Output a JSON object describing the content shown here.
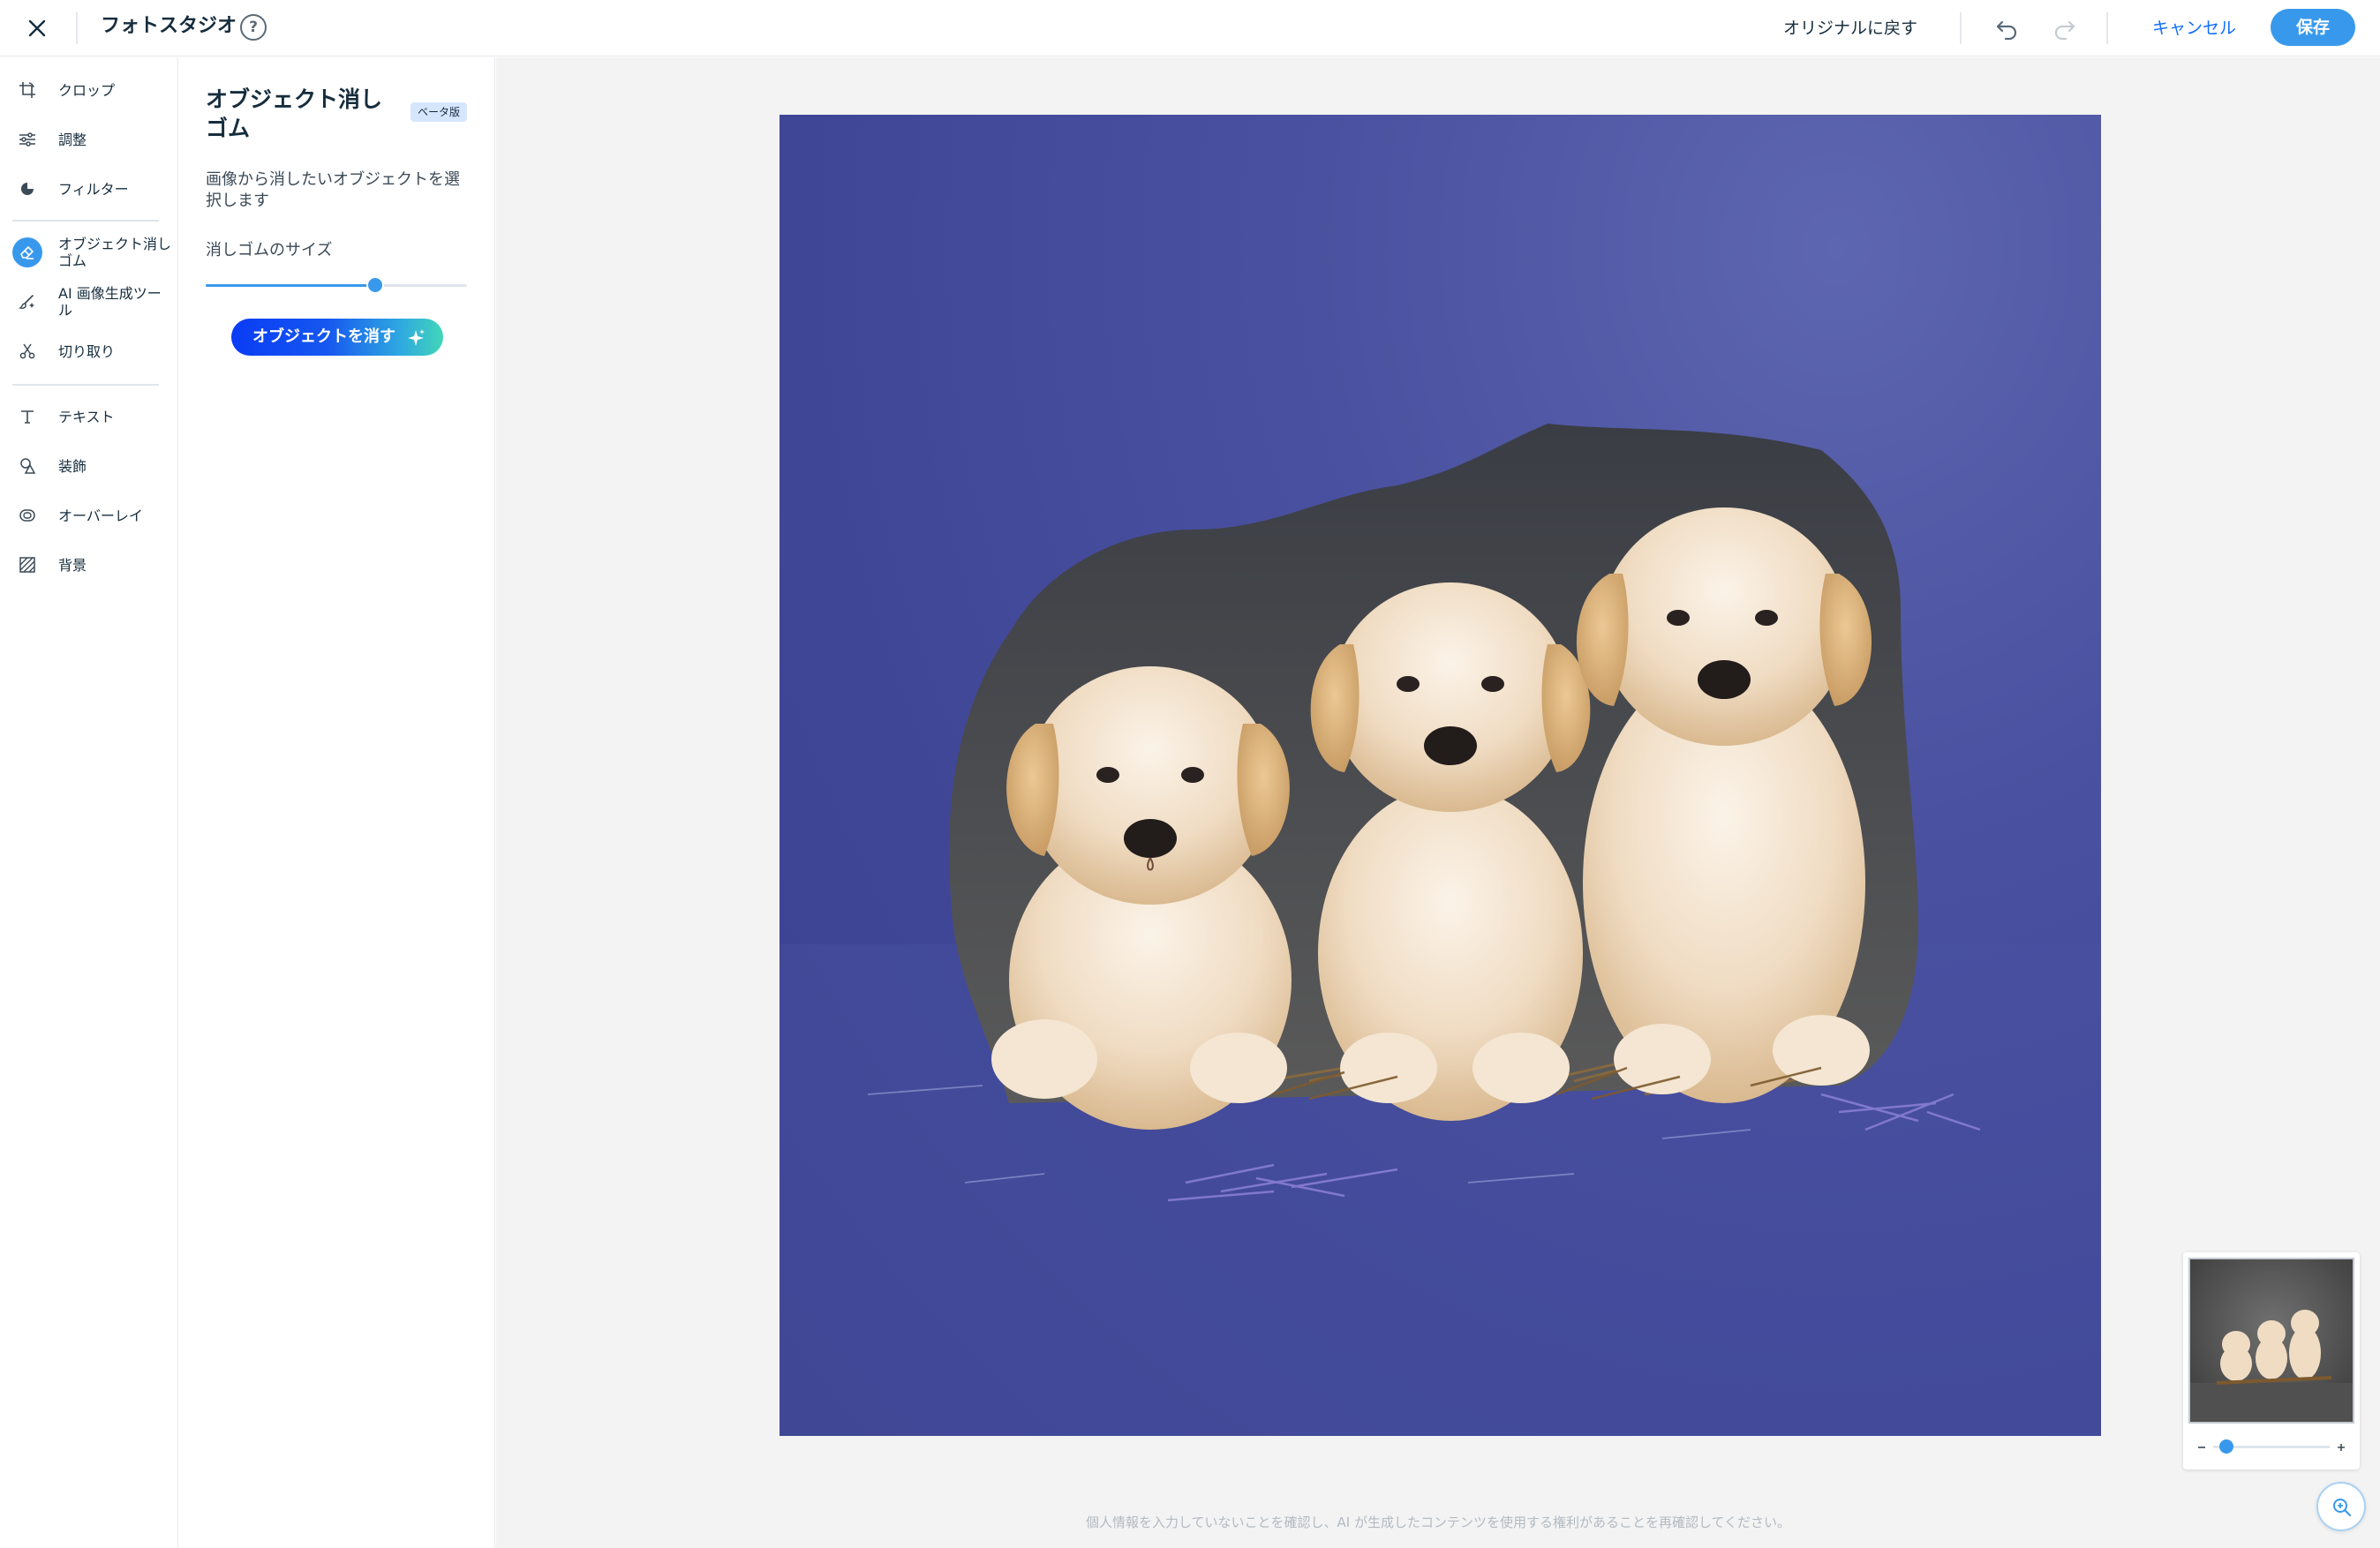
{
  "app": {
    "title": "フォトスタジオ"
  },
  "header": {
    "revert_label": "オリジナルに戻す",
    "cancel_label": "キャンセル",
    "save_label": "保存"
  },
  "sidebar": {
    "items": [
      {
        "label": "クロップ",
        "icon": "crop-icon"
      },
      {
        "label": "調整",
        "icon": "adjust-sliders-icon"
      },
      {
        "label": "フィルター",
        "icon": "filter-icon"
      },
      {
        "label": "オブジェクト消しゴム",
        "icon": "eraser-icon",
        "active": true
      },
      {
        "label": "AI 画像生成ツール",
        "icon": "brush-sparkle-icon"
      },
      {
        "label": "切り取り",
        "icon": "scissors-icon"
      },
      {
        "label": "テキスト",
        "icon": "text-icon"
      },
      {
        "label": "装飾",
        "icon": "shapes-icon"
      },
      {
        "label": "オーバーレイ",
        "icon": "overlay-icon"
      },
      {
        "label": "背景",
        "icon": "background-pattern-icon"
      }
    ]
  },
  "panel": {
    "title": "オブジェクト消しゴム",
    "badge": "ベータ版",
    "description": "画像から消したいオブジェクトを選択します",
    "size_label": "消しゴムのサイズ",
    "size_value": 0.65,
    "erase_button_label": "オブジェクトを消す"
  },
  "canvas": {
    "disclaimer": "個人情報を入力していないことを確認し、AI が生成したコンテンツを使用する権利があることを再確認してください。",
    "zoom_level": 0.05
  },
  "colors": {
    "accent": "#3899ec",
    "link": "#116dff",
    "selection_overlay": "#4a51a0",
    "canvas_bg": "#f3f3f3"
  }
}
